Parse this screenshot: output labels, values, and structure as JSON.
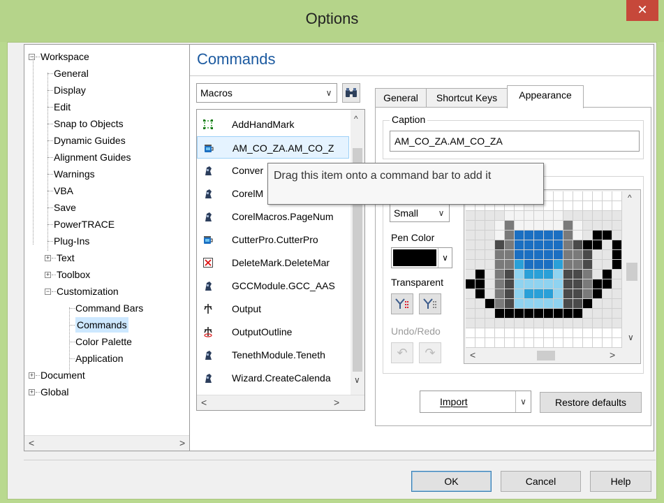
{
  "window": {
    "title": "Options",
    "close_glyph": "✕"
  },
  "tree": {
    "items": [
      {
        "label": "Workspace",
        "expander": "−"
      },
      {
        "label": "General"
      },
      {
        "label": "Display"
      },
      {
        "label": "Edit"
      },
      {
        "label": "Snap to Objects"
      },
      {
        "label": "Dynamic Guides"
      },
      {
        "label": "Alignment Guides"
      },
      {
        "label": "Warnings"
      },
      {
        "label": "VBA"
      },
      {
        "label": "Save"
      },
      {
        "label": "PowerTRACE"
      },
      {
        "label": "Plug-Ins"
      },
      {
        "label": "Text",
        "expander": "+"
      },
      {
        "label": "Toolbox",
        "expander": "+"
      },
      {
        "label": "Customization",
        "expander": "−"
      },
      {
        "label": "Command Bars"
      },
      {
        "label": "Commands"
      },
      {
        "label": "Color Palette"
      },
      {
        "label": "Application"
      },
      {
        "label": "Document",
        "expander": "+"
      },
      {
        "label": "Global",
        "expander": "+"
      }
    ],
    "scroll_left": "<",
    "scroll_right": ">"
  },
  "panel": {
    "title": "Commands",
    "category_select": {
      "value": "Macros",
      "arrow": "∨"
    },
    "find_icon": "binoculars-icon",
    "commands": [
      {
        "label": "AddHandMark",
        "icon": "handmark-icon"
      },
      {
        "label": "AM_CO_ZA.AM_CO_Z",
        "icon": "cup-icon"
      },
      {
        "label": "Conver",
        "icon": "macro-icon"
      },
      {
        "label": "CorelM",
        "icon": "macro-icon"
      },
      {
        "label": "CorelMacros.PageNum",
        "icon": "macro-icon"
      },
      {
        "label": "CutterPro.CutterPro",
        "icon": "cup-icon"
      },
      {
        "label": "DeleteMark.DeleteMar",
        "icon": "delete-box-icon"
      },
      {
        "label": "GCCModule.GCC_AAS",
        "icon": "macro-icon"
      },
      {
        "label": "Output",
        "icon": "output-icon"
      },
      {
        "label": "OutputOutline",
        "icon": "output-outline-icon"
      },
      {
        "label": "TenethModule.Teneth",
        "icon": "macro-icon"
      },
      {
        "label": "Wizard.CreateCalenda",
        "icon": "macro-icon"
      }
    ],
    "list_scroll_up": "^",
    "list_scroll_down": "∨",
    "list_scroll_left": "<",
    "list_scroll_right": ">",
    "tooltip": "Drag this item onto a command bar to add it",
    "tabs": [
      {
        "label": "General"
      },
      {
        "label": "Shortcut Keys"
      },
      {
        "label": "Appearance"
      }
    ],
    "appearance": {
      "caption_label": "Caption",
      "caption_value": "AM_CO_ZA.AM_CO_ZA",
      "size_value": "Small",
      "size_arrow": "∨",
      "pen_color_label": "Pen Color",
      "pen_color": "#000000",
      "transparent_label": "Transparent",
      "undo_redo_label": "Undo/Redo",
      "undo_glyph": "↶",
      "redo_glyph": "↷",
      "canvas_scroll_up": "^",
      "canvas_scroll_down": "∨",
      "canvas_scroll_left": "<",
      "canvas_scroll_right": ">",
      "import_label": "Import",
      "import_arrow": "∨",
      "restore_label": "Restore defaults"
    }
  },
  "footer": {
    "ok": "OK",
    "cancel": "Cancel",
    "help": "Help"
  },
  "colors": {
    "titlebar": "#b5d48a",
    "close": "#c6483a",
    "title_text": "#1c5aa0",
    "selection": "#cde8ff"
  }
}
